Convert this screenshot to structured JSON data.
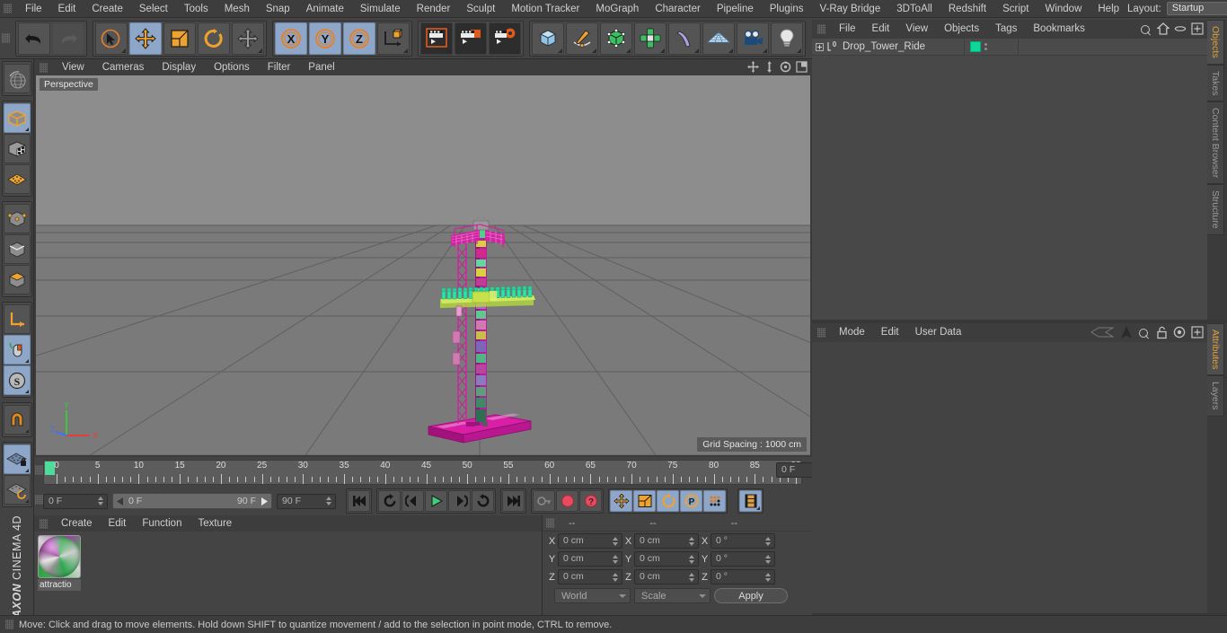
{
  "app": {
    "name": "CINEMA 4D",
    "vendor": "MAXON"
  },
  "top_menu": {
    "items": [
      "File",
      "Edit",
      "Create",
      "Select",
      "Tools",
      "Mesh",
      "Snap",
      "Animate",
      "Simulate",
      "Render",
      "Sculpt",
      "Motion Tracker",
      "MoGraph",
      "Character",
      "Pipeline",
      "Plugins",
      "V-Ray Bridge",
      "3DToAll",
      "Redshift",
      "Script",
      "Window",
      "Help"
    ],
    "layout_label": "Layout:",
    "layout_value": "Startup",
    "search_icon": "search-icon"
  },
  "toolbar": {
    "groups": [
      {
        "name": "undo-redo",
        "buttons": [
          {
            "name": "undo-button",
            "icon": "undo-icon",
            "selected": false,
            "disabled": false
          },
          {
            "name": "redo-button",
            "icon": "redo-icon",
            "selected": false,
            "disabled": true
          }
        ]
      },
      {
        "name": "tools",
        "buttons": [
          {
            "name": "live-selection-button",
            "icon": "cursor-circle-icon",
            "selected": false,
            "disabled": false
          },
          {
            "name": "move-tool-button",
            "icon": "move-arrows-icon",
            "selected": true,
            "disabled": false
          },
          {
            "name": "scale-tool-button",
            "icon": "scale-box-icon",
            "selected": false,
            "disabled": false
          },
          {
            "name": "rotate-tool-button",
            "icon": "rotate-arc-icon",
            "selected": false,
            "disabled": false
          },
          {
            "name": "drag-tool-button",
            "icon": "move-arrows-icon",
            "selected": false,
            "disabled": false
          }
        ]
      },
      {
        "name": "axis-locks",
        "buttons": [
          {
            "name": "lock-x-axis-button",
            "icon": "x-axis-icon",
            "selected": true,
            "disabled": false
          },
          {
            "name": "lock-y-axis-button",
            "icon": "y-axis-icon",
            "selected": true,
            "disabled": false
          },
          {
            "name": "lock-z-axis-button",
            "icon": "z-axis-icon",
            "selected": true,
            "disabled": false
          },
          {
            "name": "world-object-coordinates-button",
            "icon": "world-axis-cube-icon",
            "selected": false,
            "disabled": false
          }
        ]
      },
      {
        "name": "render",
        "buttons": [
          {
            "name": "render-view-button",
            "icon": "clapperboard-icon",
            "selected": false,
            "disabled": false
          },
          {
            "name": "render-to-picture-viewer-button",
            "icon": "clapperboard-picture-icon",
            "selected": false,
            "disabled": false
          },
          {
            "name": "render-settings-button",
            "icon": "clapperboard-gear-icon",
            "selected": false,
            "disabled": false
          }
        ]
      },
      {
        "name": "create",
        "buttons": [
          {
            "name": "add-cube-button",
            "icon": "cube-icon",
            "selected": false,
            "disabled": false
          },
          {
            "name": "add-spline-button",
            "icon": "pen-spline-icon",
            "selected": false,
            "disabled": false
          },
          {
            "name": "add-generator-button",
            "icon": "green-cube-icon",
            "selected": false,
            "disabled": false
          },
          {
            "name": "add-array-button",
            "icon": "array-cluster-icon",
            "selected": false,
            "disabled": false
          },
          {
            "name": "add-deformer-button",
            "icon": "bend-deformer-icon",
            "selected": false,
            "disabled": false
          },
          {
            "name": "add-environment-button",
            "icon": "floor-grid-icon",
            "selected": false,
            "disabled": false
          },
          {
            "name": "add-camera-button",
            "icon": "camera-icon",
            "selected": false,
            "disabled": false
          },
          {
            "name": "add-light-button",
            "icon": "lightbulb-icon",
            "selected": false,
            "disabled": false
          }
        ]
      }
    ]
  },
  "left_toolbar": {
    "buttons": [
      {
        "name": "undo-view-button",
        "icon": "globe-wire-icon",
        "selected": false
      },
      {
        "name": "make-editable-button",
        "icon": "editable-cube-icon",
        "selected": true
      },
      {
        "name": "texture-axis-button",
        "icon": "checker-cube-icon",
        "selected": false
      },
      {
        "name": "viewport-solo-button",
        "icon": "grid-plane-icon",
        "selected": false
      },
      {
        "name": "points-mode-button",
        "icon": "points-cube-icon",
        "selected": false
      },
      {
        "name": "edges-mode-button",
        "icon": "edges-cube-icon",
        "selected": false
      },
      {
        "name": "polygons-mode-button",
        "icon": "polygon-cube-icon",
        "selected": false
      },
      {
        "name": "enable-axis-modification-button",
        "icon": "axis-l-icon",
        "selected": false
      },
      {
        "name": "viewport-solo-single-button",
        "icon": "mouse-icon",
        "selected": true
      },
      {
        "name": "snap-settings-button",
        "icon": "s-circle-icon",
        "selected": true
      },
      {
        "name": "magnet-button",
        "icon": "magnet-icon",
        "selected": false
      },
      {
        "name": "workplane-lock-button",
        "icon": "grid-lock-icon",
        "selected": true
      },
      {
        "name": "workplane-rotate-button",
        "icon": "grid-rotate-icon",
        "selected": false
      }
    ]
  },
  "viewport": {
    "menu": [
      "View",
      "Cameras",
      "Display",
      "Options",
      "Filter",
      "Panel"
    ],
    "label": "Perspective",
    "grid_spacing": "Grid Spacing : 1000 cm",
    "nav_icons": [
      "pan-icon",
      "dolly-icon",
      "orbit-icon",
      "maximize-icon"
    ],
    "axis_gizmo": {
      "x": "X",
      "y": "Y",
      "z": "Z",
      "x_color": "#e04040",
      "y_color": "#3fc83f",
      "z_color": "#4a6ff0"
    },
    "scene": {
      "object": "Drop Tower Ride",
      "tower_color": "#cf17a0",
      "gondola_color": "#35e0a5",
      "accent_color": "#b8e03a",
      "base_color": "#cf17a0"
    }
  },
  "timeline": {
    "ticks": [
      "0",
      "5",
      "10",
      "15",
      "20",
      "25",
      "30",
      "35",
      "40",
      "45",
      "50",
      "55",
      "60",
      "65",
      "70",
      "75",
      "80",
      "85",
      "90"
    ],
    "start_frame": "0",
    "end_frame": "90",
    "current_frame_field": "0 F",
    "range_start_field": "0 F",
    "range_end_field": "90 F",
    "preview_min": "0 F",
    "preview_max": "90 F",
    "transport": [
      {
        "name": "go-to-start-button",
        "icon": "skip-start-icon"
      },
      {
        "name": "play-backwards-loop-button",
        "icon": "loop-back-icon"
      },
      {
        "name": "previous-frame-button",
        "icon": "step-back-icon"
      },
      {
        "name": "play-button",
        "icon": "play-icon"
      },
      {
        "name": "next-frame-button",
        "icon": "step-forward-icon"
      },
      {
        "name": "play-forward-loop-button",
        "icon": "loop-forward-icon"
      },
      {
        "name": "go-to-end-button",
        "icon": "skip-end-icon"
      }
    ],
    "keyframe_tools": [
      {
        "name": "record-active-objects-button",
        "icon": "key-icon",
        "selected": false,
        "disabled": true
      },
      {
        "name": "autokeying-button",
        "icon": "auto-key-icon",
        "selected": false,
        "disabled": false
      },
      {
        "name": "keyframe-selection-button",
        "icon": "question-key-icon",
        "selected": false,
        "disabled": false
      }
    ],
    "param_tools": [
      {
        "name": "position-key-button",
        "icon": "move-arrows-icon",
        "selected": true
      },
      {
        "name": "scale-key-button",
        "icon": "scale-box-icon",
        "selected": true
      },
      {
        "name": "rotation-key-button",
        "icon": "rotate-arc-icon",
        "selected": true
      },
      {
        "name": "pla-key-button",
        "icon": "p-circle-icon",
        "selected": true
      },
      {
        "name": "point-level-animation-button",
        "icon": "dot-grid-icon",
        "selected": true
      }
    ],
    "timeline_mode_button": {
      "name": "timeline-filmstrip-button",
      "icon": "filmstrip-icon",
      "selected": true
    }
  },
  "materials": {
    "menu": [
      "Create",
      "Edit",
      "Function",
      "Texture"
    ],
    "items": [
      {
        "name": "attractio",
        "label": "attractio"
      }
    ]
  },
  "coordinates": {
    "headers": [
      "--",
      "--",
      "--"
    ],
    "rows": [
      {
        "axis": "X",
        "position": "0 cm",
        "size": "0 cm",
        "rotation": "0 °"
      },
      {
        "axis": "Y",
        "position": "0 cm",
        "size": "0 cm",
        "rotation": "0 °"
      },
      {
        "axis": "Z",
        "position": "0 cm",
        "size": "0 cm",
        "rotation": "0 °"
      }
    ],
    "coord_system": "World",
    "size_mode": "Scale",
    "apply_label": "Apply"
  },
  "object_manager": {
    "menu": [
      "File",
      "Edit",
      "View",
      "Objects",
      "Tags",
      "Bookmarks"
    ],
    "icons": [
      "search-icon",
      "home-icon",
      "ellipse-icon",
      "maximize-icon"
    ],
    "rows": [
      {
        "name": "Drop_Tower_Ride",
        "icon": "null-object-icon",
        "tag_color": "#0fd79a",
        "expandable": true
      }
    ]
  },
  "attribute_manager": {
    "menu": [
      "Mode",
      "Edit",
      "User Data"
    ],
    "icons": [
      "history-icon",
      "arrow-up-icon",
      "search-icon",
      "lock-icon",
      "target-icon",
      "maximize-icon"
    ]
  },
  "right_tabs_top": [
    {
      "label": "Objects",
      "active": true
    },
    {
      "label": "Takes",
      "active": false
    },
    {
      "label": "Content Browser",
      "active": false
    },
    {
      "label": "Structure",
      "active": false
    }
  ],
  "right_tabs_bottom": [
    {
      "label": "Attributes",
      "active": true
    },
    {
      "label": "Layers",
      "active": false
    }
  ],
  "status_bar": {
    "message": "Move: Click and drag to move elements. Hold down SHIFT to quantize movement / add to the selection in point mode, CTRL to remove."
  }
}
